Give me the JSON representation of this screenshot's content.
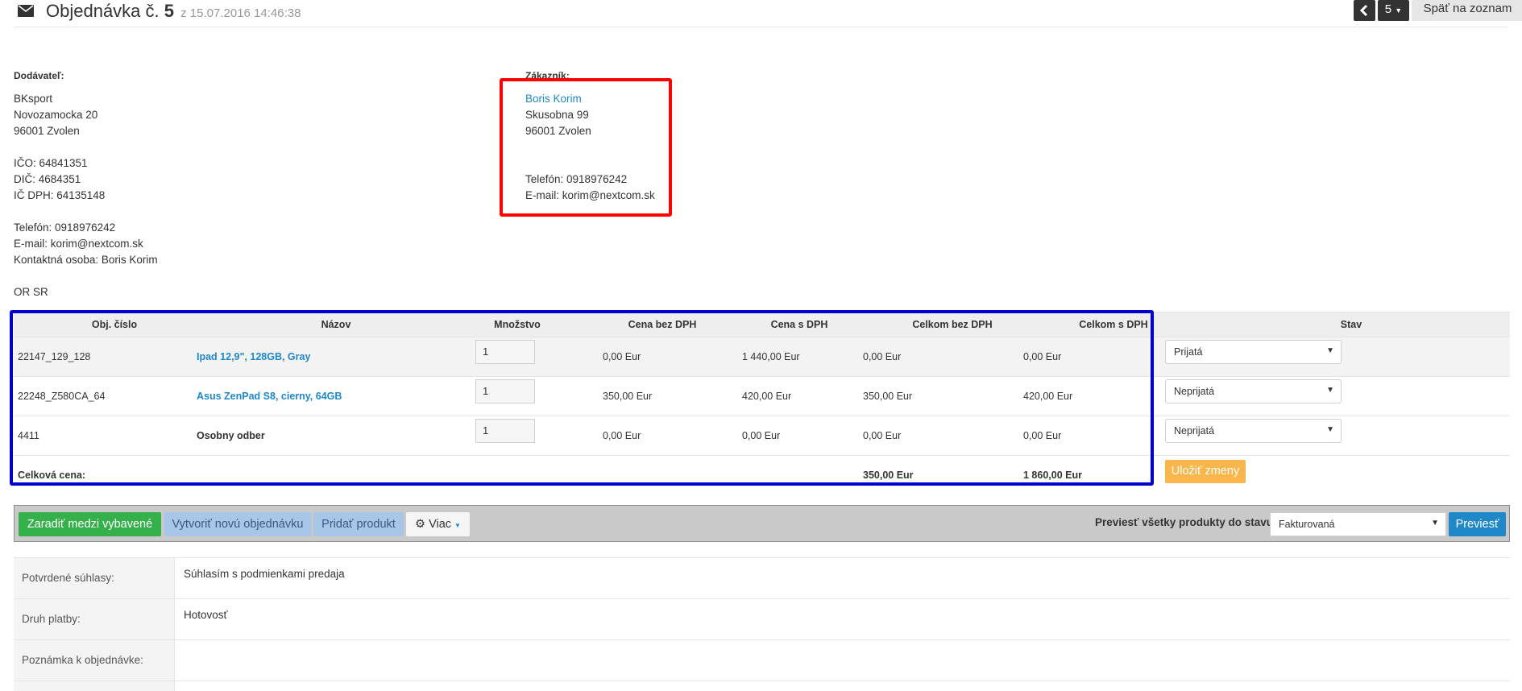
{
  "header": {
    "title_prefix": "Objednávka č.",
    "order_number": "5",
    "date": "z 15.07.2016 14:46:38",
    "page_select": "5",
    "back_label": "Späť na zoznam"
  },
  "supplier": {
    "label": "Dodávateľ:",
    "name": "BKsport",
    "street": "Novozamocka 20",
    "city": "96001 Zvolen",
    "ico": "IČO: 64841351",
    "dic": "DIČ: 4684351",
    "icdph": "IČ DPH: 64135148",
    "phone": "Telefón: 0918976242",
    "email": "E-mail: korim@nextcom.sk",
    "contact": "Kontaktná osoba: Boris Korim",
    "register": "OR SR"
  },
  "customer": {
    "label": "Zákazník:",
    "name": "Boris Korim",
    "street": "Skusobna 99",
    "city": "96001 Zvolen",
    "phone": "Telefón: 0918976242",
    "email": "E-mail: korim@nextcom.sk"
  },
  "table": {
    "headers": [
      "Obj. číslo",
      "Názov",
      "Množstvo",
      "Cena bez DPH",
      "Cena s DPH",
      "Celkom bez DPH",
      "Celkom s DPH",
      "Stav"
    ],
    "rows": [
      {
        "code": "22147_129_128",
        "name": "Ipad 12,9\", 128GB, Gray",
        "qty": "1",
        "price": "0,00 Eur",
        "price_vat": "1 440,00 Eur",
        "total": "0,00 Eur",
        "total_vat": "0,00 Eur",
        "status": "Prijatá"
      },
      {
        "code": "22248_Z580CA_64",
        "name": "Asus ZenPad S8, cierny, 64GB",
        "qty": "1",
        "price": "350,00 Eur",
        "price_vat": "420,00 Eur",
        "total": "350,00 Eur",
        "total_vat": "420,00 Eur",
        "status": "Neprijatá"
      },
      {
        "code": "4411",
        "name": "Osobny odber",
        "qty": "1",
        "price": "0,00 Eur",
        "price_vat": "0,00 Eur",
        "total": "0,00 Eur",
        "total_vat": "0,00 Eur",
        "status": "Neprijatá"
      }
    ],
    "summary_label": "Celková cena:",
    "summary_total": "350,00 Eur",
    "summary_total_vat": "1 860,00 Eur",
    "save_label": "Uložiť zmeny"
  },
  "actions": {
    "add_selected": "Zaradiť medzi vybavené",
    "new_order": "Vytvoriť novú objednávku",
    "add_product": "Pridať produkt",
    "more": "Viac",
    "move_label": "Previesť všetky produkty do stavu",
    "move_select": "Fakturovaná",
    "move_button": "Previesť"
  },
  "details": [
    {
      "label": "Potvrdené súhlasy:",
      "value": "Súhlasím s podmienkami predaja"
    },
    {
      "label": "Druh platby:",
      "value": "Hotovosť"
    },
    {
      "label": "Poznámka k objednávke:",
      "value": ""
    }
  ],
  "colors": {
    "accent": "#1e88c9",
    "success": "#35b04a",
    "warning": "#f8b64c",
    "highlight_red": "#ff0000",
    "highlight_blue": "#0000cc"
  }
}
